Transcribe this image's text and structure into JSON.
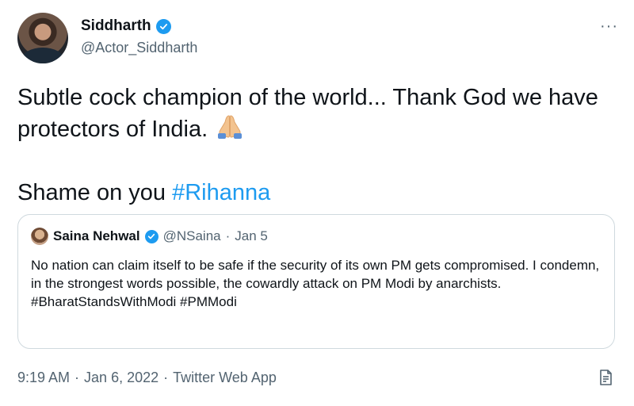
{
  "author": {
    "display_name": "Siddharth",
    "handle": "@Actor_Siddharth",
    "verified": true,
    "avatar_icon": "profile-photo"
  },
  "more_menu": {
    "label": "···",
    "icon": "more-horizontal-icon"
  },
  "tweet": {
    "line1": "Subtle cock champion of the world... Thank God we have protectors of India.",
    "emoji_icon": "folded-hands-icon",
    "line2_prefix": "Shame on you ",
    "line2_hashtag": "#Rihanna"
  },
  "quoted_tweet": {
    "display_name": "Saina Nehwal",
    "handle": "@NSaina",
    "separator": "·",
    "date": "Jan 5",
    "verified": true,
    "text_body": "No nation can claim itself to be safe if the security of its own PM gets compromised. I condemn, in the strongest words possible, the cowardly attack on PM Modi by anarchists.",
    "hashtags": "#BharatStandsWithModi #PMModi"
  },
  "meta": {
    "time": "9:19 AM",
    "separator": "·",
    "date": "Jan 6, 2022",
    "source": "Twitter Web App",
    "analytics_icon": "tweet-activity-icon"
  },
  "colors": {
    "accent": "#1d9bf0",
    "text_primary": "#0f1419",
    "text_secondary": "#536471",
    "border": "#cfd9de"
  }
}
